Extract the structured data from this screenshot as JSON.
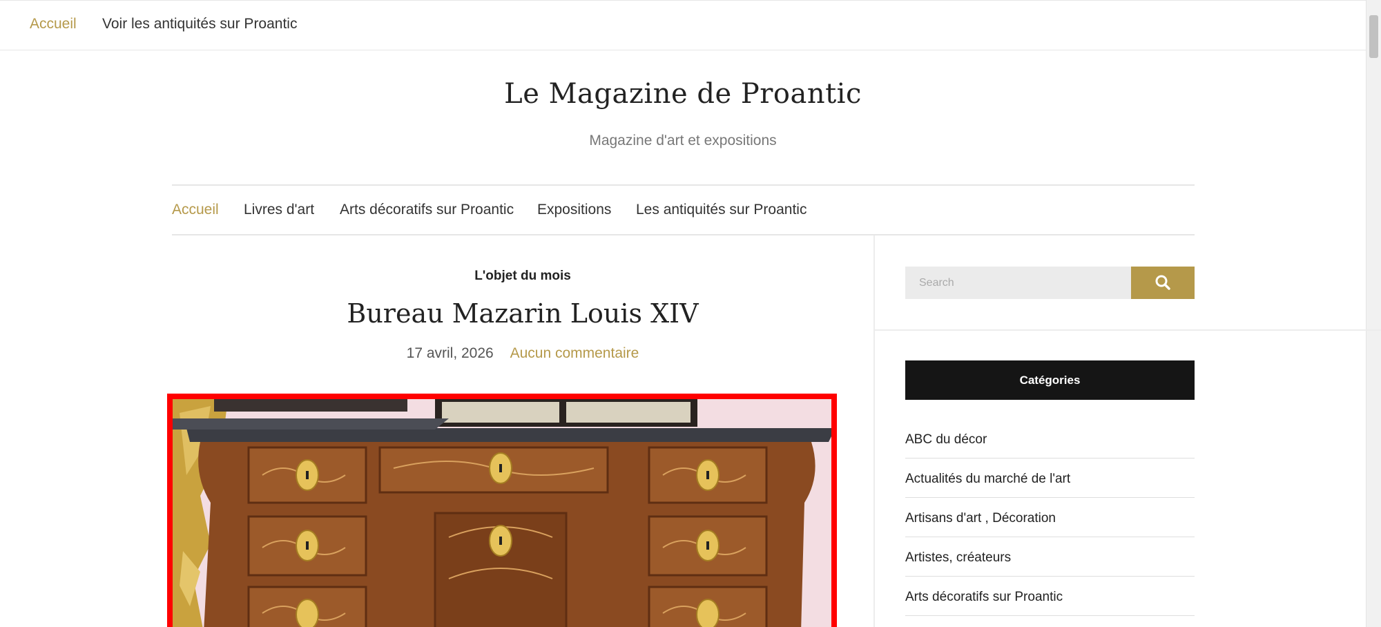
{
  "topbar": {
    "items": [
      {
        "label": "Accueil"
      },
      {
        "label": "Voir les antiquités sur Proantic"
      }
    ]
  },
  "site": {
    "title": "Le Magazine de Proantic",
    "tagline": "Magazine d'art et expositions"
  },
  "main_nav": {
    "items": [
      {
        "label": "Accueil"
      },
      {
        "label": "Livres d'art"
      },
      {
        "label": "Arts décoratifs sur Proantic"
      },
      {
        "label": "Expositions"
      },
      {
        "label": "Les antiquités sur Proantic"
      }
    ]
  },
  "post": {
    "category": "L'objet du mois",
    "title": "Bureau Mazarin Louis XIV",
    "date": "17 avril, 2026",
    "comments": "Aucun commentaire"
  },
  "sidebar": {
    "search": {
      "placeholder": "Search"
    },
    "categories_title": "Catégories",
    "categories": [
      {
        "label": "ABC du décor"
      },
      {
        "label": "Actualités du marché de l'art"
      },
      {
        "label": "Artisans d'art , Décoration"
      },
      {
        "label": "Artistes, créateurs"
      },
      {
        "label": "Arts décoratifs sur Proantic"
      }
    ]
  },
  "colors": {
    "accent": "#b5994a",
    "highlight_border": "#ff0000",
    "widget_header": "#151515"
  },
  "icons": {
    "search": "search-icon"
  }
}
